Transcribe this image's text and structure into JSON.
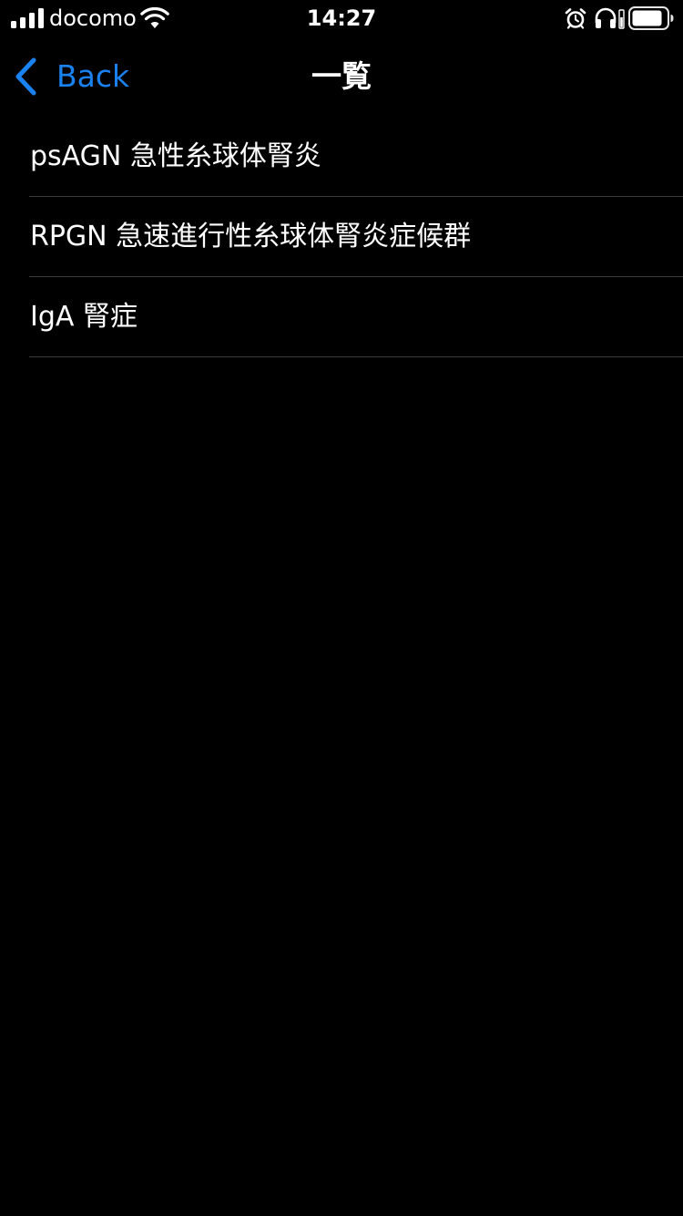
{
  "status_bar": {
    "carrier": "docomo",
    "time": "14:27",
    "icons": [
      "signal-icon",
      "wifi-icon",
      "alarm-icon",
      "headphones-icon",
      "battery-icon"
    ]
  },
  "nav": {
    "back_label": "Back",
    "title": "一覧"
  },
  "list": {
    "items": [
      {
        "label": "psAGN 急性糸球体腎炎"
      },
      {
        "label": "RPGN 急速進行性糸球体腎炎症候群"
      },
      {
        "label": "IgA 腎症"
      }
    ]
  },
  "colors": {
    "background": "#000000",
    "text": "#ffffff",
    "accent": "#1a82f0",
    "separator": "#3a3a3c"
  }
}
